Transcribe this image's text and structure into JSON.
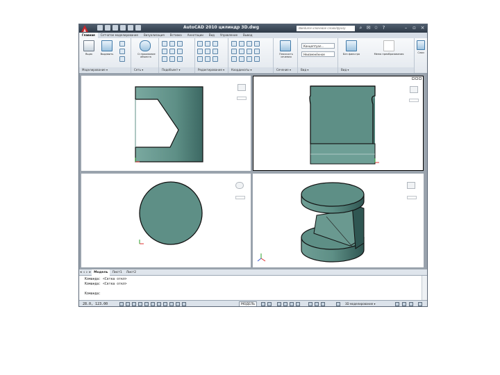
{
  "window": {
    "title": "AutoCAD 2010   цилиндр 3D.dwg",
    "search_placeholder": "Введите ключевое слово/фразу"
  },
  "ribbon_tabs": [
    {
      "label": "Главная",
      "active": true
    },
    {
      "label": "Сетчатое моделирование",
      "active": false
    },
    {
      "label": "Визуализация",
      "active": false
    },
    {
      "label": "Вставка",
      "active": false
    },
    {
      "label": "Аннотации",
      "active": false
    },
    {
      "label": "Вид",
      "active": false
    },
    {
      "label": "Управление",
      "active": false
    },
    {
      "label": "Вывод",
      "active": false
    }
  ],
  "ribbon_groups": {
    "modeling": {
      "label": "Моделирование ▾",
      "buttons": [
        "Ящик",
        "Выдавить"
      ],
      "smooth_label": "Сглаживание объекта"
    },
    "mesh": {
      "label": "Сеть ▾"
    },
    "edit": {
      "label": "Редактирование ▾"
    },
    "section": {
      "label": "Сечение ▾",
      "button": "Плоскость сечения"
    },
    "view": {
      "label": "Вид ▾",
      "dd1": "Концептуал...",
      "dd2": "Неизменённое"
    },
    "subobject": {
      "label": "Подобъект ▾"
    },
    "coords": {
      "label": "Координаты ▾"
    },
    "transform": {
      "label": "Вид ▾",
      "dd_label": "Без фильтра",
      "move_label": "Меню преобразования"
    },
    "layers": {
      "label": "Слои"
    }
  },
  "layout_tabs": [
    "Модель",
    "Лист1",
    "Лист2"
  ],
  "command_line": {
    "line1": "Команда:  <Сетка откл>",
    "line2": "Команда:  <Сетка откл>",
    "line3": "Команда:"
  },
  "status": {
    "coords": "28.0, 123.00",
    "model_label": "МОДЕЛЬ",
    "workspace": "3D моделирование ▾"
  },
  "colors": {
    "solid_fill": "#5e8f86",
    "solid_dark": "#3f6b66",
    "ucs_red": "#e03030",
    "ucs_green": "#2aa02a"
  }
}
